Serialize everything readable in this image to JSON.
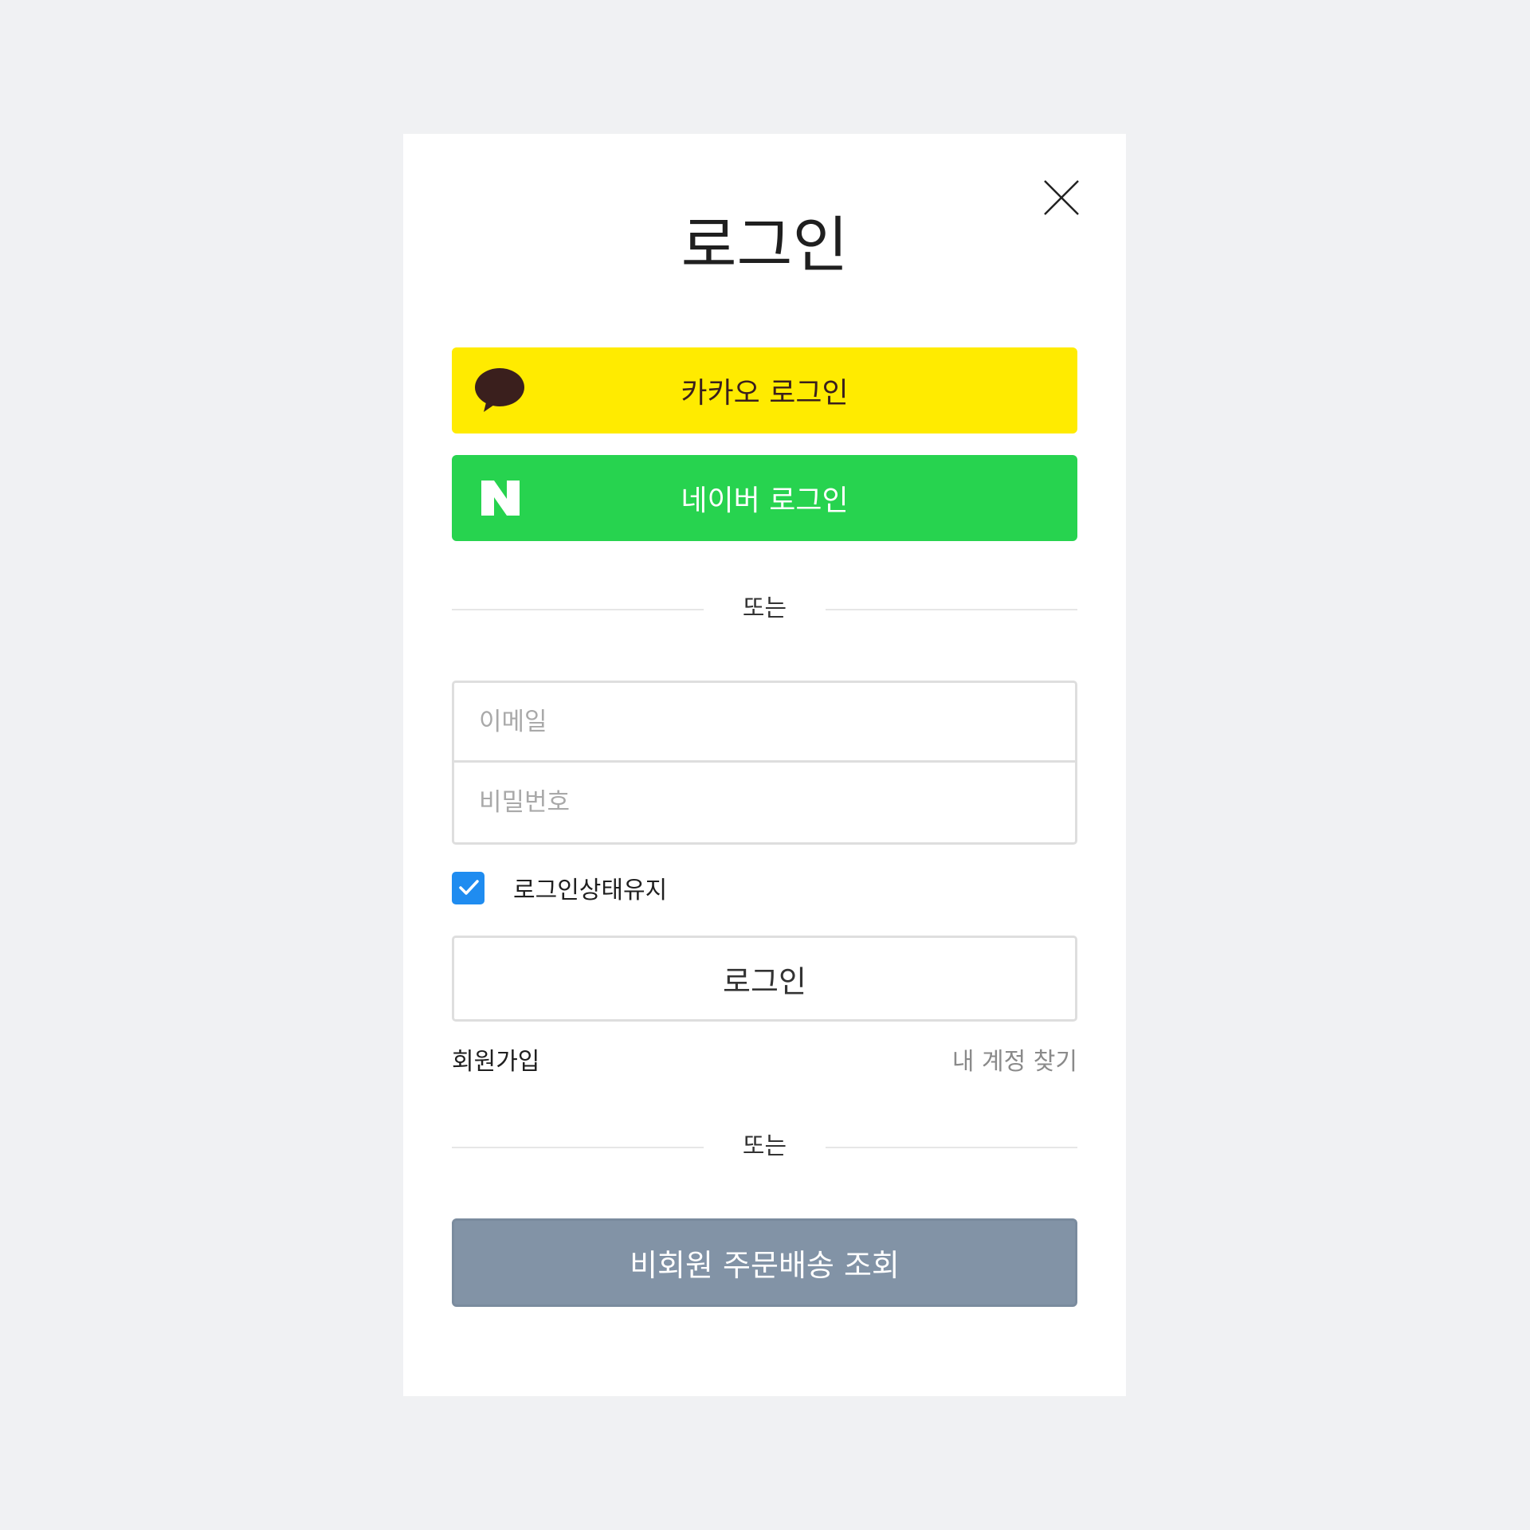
{
  "modal": {
    "title": "로그인",
    "close_icon": "close-icon"
  },
  "social": {
    "kakao": {
      "label": "카카오 로그인",
      "icon": "kakao-talk-bubble-icon",
      "bg_color": "#ffeb00",
      "text_color": "#3a1f1d"
    },
    "naver": {
      "label": "네이버 로그인",
      "icon": "naver-n-icon",
      "bg_color": "#27d34f",
      "text_color": "#ffffff"
    }
  },
  "divider_1": {
    "label": "또는"
  },
  "form": {
    "email_placeholder": "이메일",
    "email_value": "",
    "password_placeholder": "비밀번호",
    "password_value": "",
    "keep_logged_in": {
      "label": "로그인상태유지",
      "checked": true,
      "color": "#1f8cf0"
    },
    "submit_label": "로그인"
  },
  "links": {
    "signup": "회원가입",
    "find_account": "내 계정 찾기"
  },
  "divider_2": {
    "label": "또는"
  },
  "guest": {
    "label": "비회원 주문배송 조회",
    "bg_color": "#8293a6"
  }
}
